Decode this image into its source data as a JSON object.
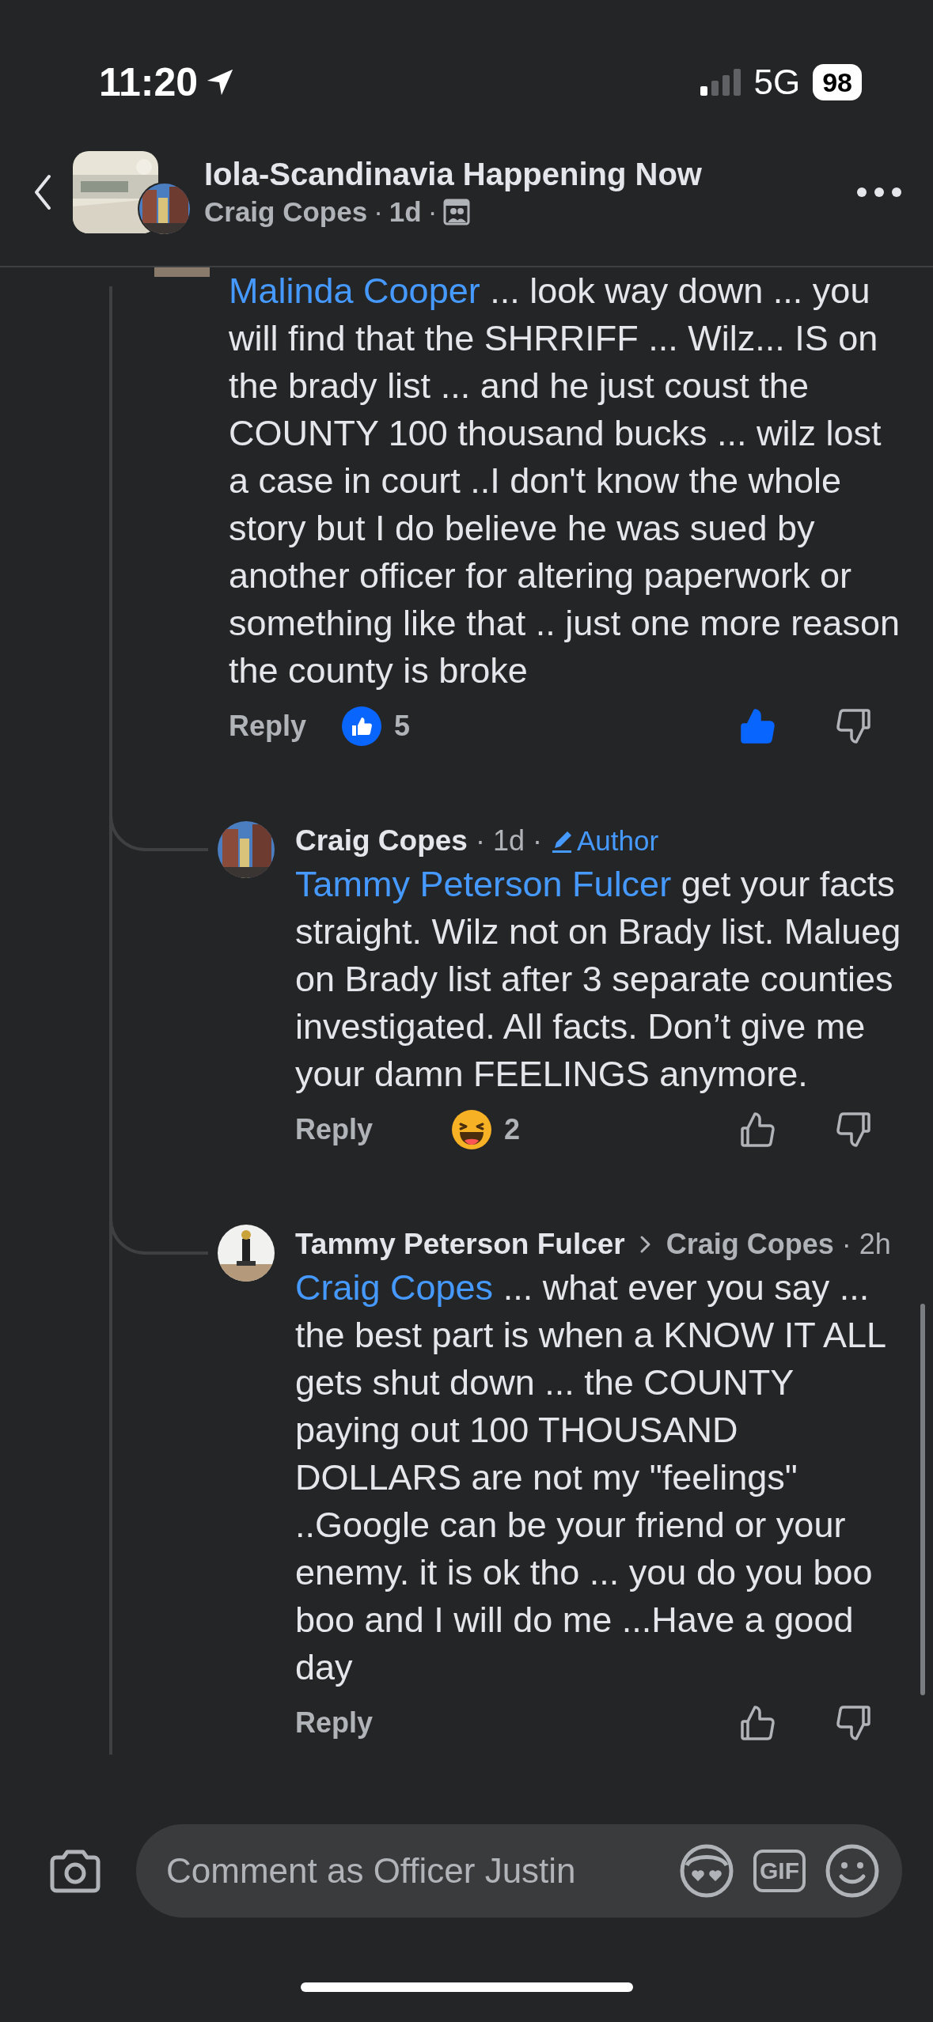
{
  "status_bar": {
    "time": "11:20",
    "network": "5G",
    "battery": "98"
  },
  "header": {
    "title": "Iola-Scandinavia Happening Now",
    "subtitle": [
      "Craig Copes",
      "·",
      "1d",
      "·"
    ]
  },
  "comments": [
    {
      "mention": "Malinda Cooper",
      "text": "  ... look way down ... you will find that the SHRRIFF ... Wilz... IS on the brady list ... and he just coust the COUNTY 100 thousand bucks ... wilz lost a case in court ..I don't know the whole story but I do believe he was sued by another officer for altering paperwork or something like that  .. just one more reason the county is broke",
      "reply": "Reply",
      "reaction": {
        "kind": "like",
        "count": "5"
      },
      "liked": true,
      "children": [
        {
          "author": "Craig Copes",
          "meta": [
            {
              "kind": "dot",
              "text": "·"
            },
            {
              "kind": "time",
              "text": "1d"
            },
            {
              "kind": "dot",
              "text": "·"
            },
            {
              "kind": "badge",
              "text": "Author"
            }
          ],
          "mention": "Tammy Peterson Fulcer",
          "text": " get your facts straight. Wilz not on Brady list. Malueg on Brady list after 3 separate counties investigated. All facts. Don’t give me your damn FEELINGS anymore.",
          "reply": "Reply",
          "reaction": {
            "kind": "haha",
            "count": "2"
          },
          "liked": false
        },
        {
          "author": "Tammy Peterson Fulcer",
          "meta": [
            {
              "kind": "reply_to",
              "text": "Craig Copes"
            },
            {
              "kind": "dot",
              "text": "·"
            },
            {
              "kind": "time",
              "text": "2h"
            }
          ],
          "mention": "Craig Copes",
          "text": " ... what ever you say ... the best part is when a KNOW IT ALL gets shut down ... the COUNTY paying out 100 THOUSAND DOLLARS are not my \"feelings\" ..Google can be your friend or your enemy. it is ok tho ... you do you boo boo and I will do me ...Have a good day",
          "reply": "Reply",
          "liked": false
        }
      ]
    }
  ],
  "composer": {
    "placeholder": "Comment as Officer Justin",
    "gif": "GIF"
  }
}
